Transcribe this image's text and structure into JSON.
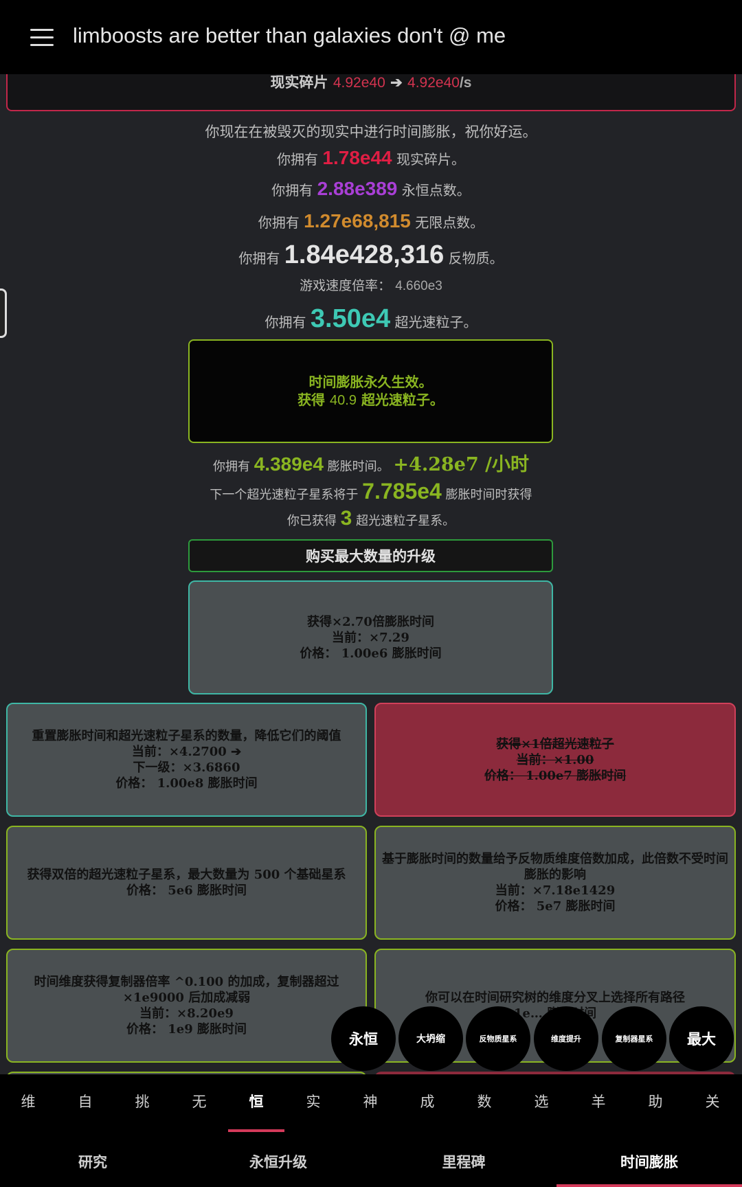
{
  "header": {
    "title": "limboosts are better than galaxies don't @ me"
  },
  "reality": {
    "label": "现实碎片",
    "amount": "4.92e40",
    "arrow": "➔",
    "rate": "4.92e40",
    "rate_unit": "/s"
  },
  "stats": {
    "warning": "你现在在被毁灭的现实中进行时间膨胀，祝你好运。",
    "you_have": "你拥有",
    "shards_value": "1.78e44",
    "shards_unit": "现实碎片。",
    "eternity_value": "2.88e389",
    "eternity_unit": "永恒点数。",
    "infinity_value": "1.27e68,815",
    "infinity_unit": "无限点数。",
    "antimatter_value": "1.84e428,316",
    "antimatter_unit": "反物质。",
    "speed_label": "游戏速度倍率：",
    "speed_value": "4.660e3",
    "tachyon_value": "3.50e4",
    "tachyon_unit": "超光速粒子。"
  },
  "dilation": {
    "line1": "时间膨胀永久生效。",
    "line2_prefix": "获得",
    "line2_value": "40.9",
    "line2_suffix": "超光速粒子。",
    "dilated_prefix": "你拥有",
    "dilated_value": "4.389e4",
    "dilated_unit": "膨胀时间。",
    "dilated_rate": "+4.28e7 /小时",
    "next_prefix": "下一个超光速粒子星系将于",
    "next_value": "7.785e4",
    "next_suffix": "膨胀时间时获得",
    "galaxies_prefix": "你已获得",
    "galaxies_value": "3",
    "galaxies_suffix": "超光速粒子星系。",
    "buy_max": "购买最大数量的升级"
  },
  "upgrades": {
    "u1": {
      "l1": "获得×2.70倍膨胀时间",
      "l2": "当前：×7.29",
      "l3": "价格： 1.00e6 膨胀时间"
    },
    "u2": {
      "l1": "重置膨胀时间和超光速粒子星系的数量，降低它们的阈值",
      "l2": "当前：×4.2700 ➔",
      "l3": "下一级：×3.6860",
      "l4": "价格： 1.00e8 膨胀时间"
    },
    "u3": {
      "l1": "获得×1倍超光速粒子",
      "l2": "当前：×1.00",
      "l3": "价格： 1.00e7 膨胀时间"
    },
    "u4": {
      "l1": "获得双倍的超光速粒子星系，最大数量为 500 个基础星系",
      "l2": "价格： 5e6 膨胀时间"
    },
    "u5": {
      "l1": "基于膨胀时间的数量给予反物质维度倍数加成，此倍数不受时间膨胀的影响",
      "l2": "当前：×7.18e1429",
      "l3": "价格： 5e7 膨胀时间"
    },
    "u6": {
      "l1": "时间维度获得复制器倍率 ^0.100 的加成，复制器超过 ×1e9000 后加成减弱",
      "l2": "当前：×8.20e9",
      "l3": "价格： 1e9 膨胀时间"
    },
    "u7": {
      "l1": "你可以在时间研究树的维度分叉上选择所有路径",
      "l2": "1e… 膨胀时间"
    }
  },
  "shortcuts": [
    "永恒",
    "大坍缩",
    "反物质星系",
    "维度提升",
    "复制器星系",
    "最大"
  ],
  "tabs_top": [
    "维",
    "自",
    "挑",
    "无",
    "恒",
    "实",
    "神",
    "成",
    "数",
    "选",
    "羊",
    "助",
    "关"
  ],
  "tabs_bottom": [
    "研究",
    "永恒升级",
    "里程碑",
    "时间膨胀"
  ],
  "colors": {
    "reality": "#d2334f",
    "eternity": "#a93fd6",
    "infinity": "#d18b2e",
    "tachyon": "#3ec9b4",
    "dilation": "#8ab521",
    "active_tab": "#d43a5a"
  }
}
